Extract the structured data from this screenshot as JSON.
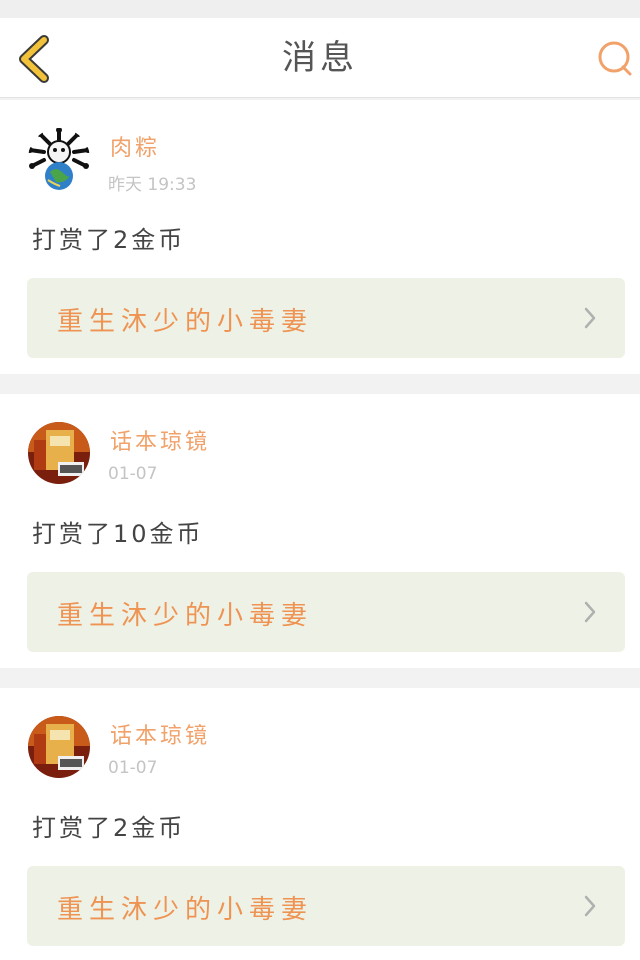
{
  "header": {
    "title": "消息",
    "back_icon": "chevron-left-icon",
    "search_icon": "search-icon",
    "accent_colors": {
      "back": "#f2c23a",
      "search": "#f0a26a"
    }
  },
  "colors": {
    "username": "#f0a26a",
    "book_title": "#ee9352",
    "book_bg": "#eef2e6",
    "timestamp": "#c4c4c4"
  },
  "messages": [
    {
      "username": "肉粽",
      "time": "昨天 19:33",
      "text": "打赏了2金币",
      "book": "重生沐少的小毒妻",
      "avatar": "skull-globe-avatar"
    },
    {
      "username": "话本琼镜",
      "time": "01-07",
      "text": "打赏了10金币",
      "book": "重生沐少的小毒妻",
      "avatar": "book-cover-avatar"
    },
    {
      "username": "话本琼镜",
      "time": "01-07",
      "text": "打赏了2金币",
      "book": "重生沐少的小毒妻",
      "avatar": "book-cover-avatar"
    }
  ]
}
